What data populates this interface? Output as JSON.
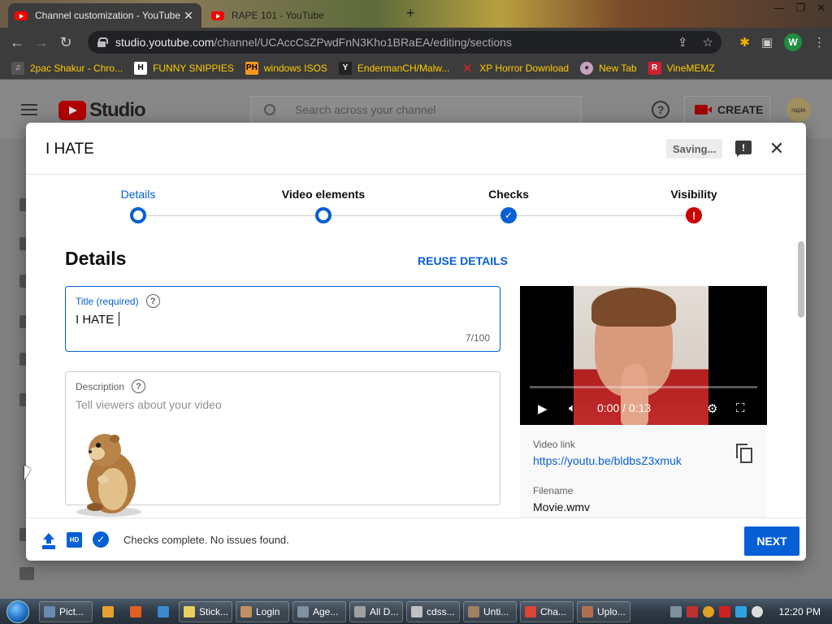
{
  "browser": {
    "tabs": [
      {
        "title": "Channel customization - YouTube",
        "active": true
      },
      {
        "title": "RAPE 101 - YouTube",
        "active": false
      }
    ],
    "url_host": "studio.youtube.com",
    "url_path": "/channel/UCAccCsZPwdFnN3Kho1BRaEA/editing/sections",
    "profile_initial": "W",
    "bookmarks": [
      {
        "label": "2pac Shakur - Chro...",
        "icon": "music-icon"
      },
      {
        "label": "FUNNY SNIPPIES",
        "icon": "h-icon"
      },
      {
        "label": "windows ISOS",
        "icon": "ph-icon"
      },
      {
        "label": "EndermanCH/Malw...",
        "icon": "yp-icon"
      },
      {
        "label": "XP Horror Download",
        "icon": "x-icon"
      },
      {
        "label": "New Tab",
        "icon": "globe-icon"
      },
      {
        "label": "VineMEMZ",
        "icon": "r-icon"
      }
    ]
  },
  "studio": {
    "logo_text": "Studio",
    "search_placeholder": "Search across your channel",
    "create_label": "CREATE",
    "avatar_text": "rapie"
  },
  "modal": {
    "title": "I HATE",
    "saving_label": "Saving...",
    "steps": [
      {
        "label": "Details",
        "state": "active"
      },
      {
        "label": "Video elements",
        "state": "ring"
      },
      {
        "label": "Checks",
        "state": "check"
      },
      {
        "label": "Visibility",
        "state": "error"
      }
    ],
    "section_title": "Details",
    "reuse_label": "REUSE DETAILS",
    "title_field": {
      "label": "Title (required)",
      "value": "I HATE ",
      "counter": "7/100"
    },
    "description_field": {
      "label": "Description",
      "placeholder": "Tell viewers about your video"
    },
    "video": {
      "time": "0:00 / 0:13",
      "link_label": "Video link",
      "link": "https://youtu.be/bldbsZ3xmuk",
      "filename_label": "Filename",
      "filename": "Movie.wmv"
    },
    "footer_status": "Checks complete. No issues found.",
    "next_label": "NEXT"
  },
  "taskbar": {
    "items": [
      {
        "label": "Pict...",
        "color": "#6a8ab0"
      },
      {
        "label": "",
        "color": "#e8a030"
      },
      {
        "label": "",
        "color": "#e06020"
      },
      {
        "label": "",
        "color": "#3a8ad0"
      },
      {
        "label": "Stick...",
        "color": "#e8d060"
      },
      {
        "label": "Login",
        "color": "#c09060"
      },
      {
        "label": "Age...",
        "color": "#8090a0"
      },
      {
        "label": "All D...",
        "color": "#a0a0a0"
      },
      {
        "label": "cdss...",
        "color": "#c0c0c0"
      },
      {
        "label": "Unti...",
        "color": "#a08060"
      },
      {
        "label": "Cha...",
        "color": "#db4437"
      },
      {
        "label": "Uplo...",
        "color": "#b07050"
      }
    ],
    "clock": "12:20 PM"
  }
}
